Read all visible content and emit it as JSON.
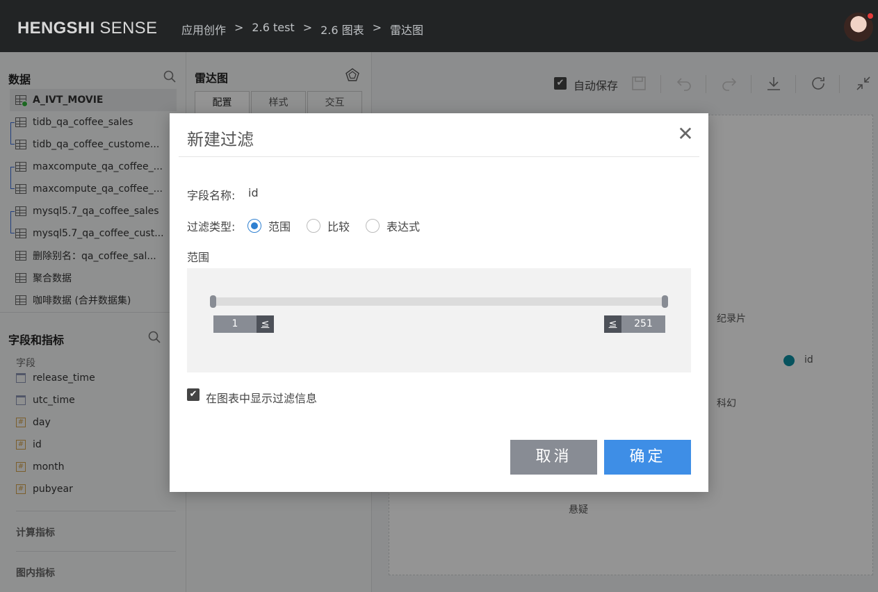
{
  "header": {
    "brand_bold": "HENGSHI",
    "brand_light": " SENSE",
    "breadcrumb": [
      "应用创作",
      "2.6 test",
      "2.6 图表",
      "雷达图"
    ],
    "breadcrumb_sep": ">"
  },
  "sidebar": {
    "data_title": "数据",
    "datasets": [
      "A_IVT_MOVIE",
      "tidb_qa_coffee_sales",
      "tidb_qa_coffee_custome...",
      "maxcompute_qa_coffee_...",
      "maxcompute_qa_coffee_...",
      "mysql5.7_qa_coffee_sales",
      "mysql5.7_qa_coffee_cust...",
      "删除别名：qa_coffee_sal...",
      "聚合数据",
      "咖啡数据 (合并数据集)"
    ],
    "fields_title": "字段和指标",
    "fields_label": "字段",
    "fields": [
      {
        "name": "release_time",
        "type": "date"
      },
      {
        "name": "utc_time",
        "type": "date"
      },
      {
        "name": "day",
        "type": "number"
      },
      {
        "name": "id",
        "type": "number"
      },
      {
        "name": "month",
        "type": "number"
      },
      {
        "name": "pubyear",
        "type": "number"
      }
    ],
    "number_icon": "#",
    "calc_metrics": "计算指标",
    "chart_metrics": "图内指标"
  },
  "config": {
    "title": "雷达图",
    "tabs": [
      "配置",
      "样式",
      "交互"
    ]
  },
  "toolbar": {
    "autosave_label": "自动保存",
    "check": "✔",
    "icons": [
      "save-icon",
      "undo-icon",
      "redo-icon",
      "download-icon",
      "refresh-icon",
      "collapse-icon"
    ]
  },
  "chart": {
    "labels": [
      "纪录片",
      "科幻",
      "悬疑"
    ],
    "legend": "id"
  },
  "modal": {
    "title": "新建过滤",
    "close": "✕",
    "field_label": "字段名称:",
    "field_value": "id",
    "filter_type_label": "过滤类型:",
    "filter_types": [
      "范围",
      "比较",
      "表达式"
    ],
    "selected_type": "范围",
    "range_label": "范围",
    "range_min": "1",
    "range_max": "251",
    "op_left": "≤",
    "op_right": "≤",
    "show_filter_info": "在图表中显示过滤信息",
    "show_filter_checked": true,
    "cancel": "取消",
    "confirm": "确定"
  },
  "colors": {
    "accent": "#3e8ee6",
    "topbar": "#222425",
    "legend": "#0d8fa3"
  }
}
